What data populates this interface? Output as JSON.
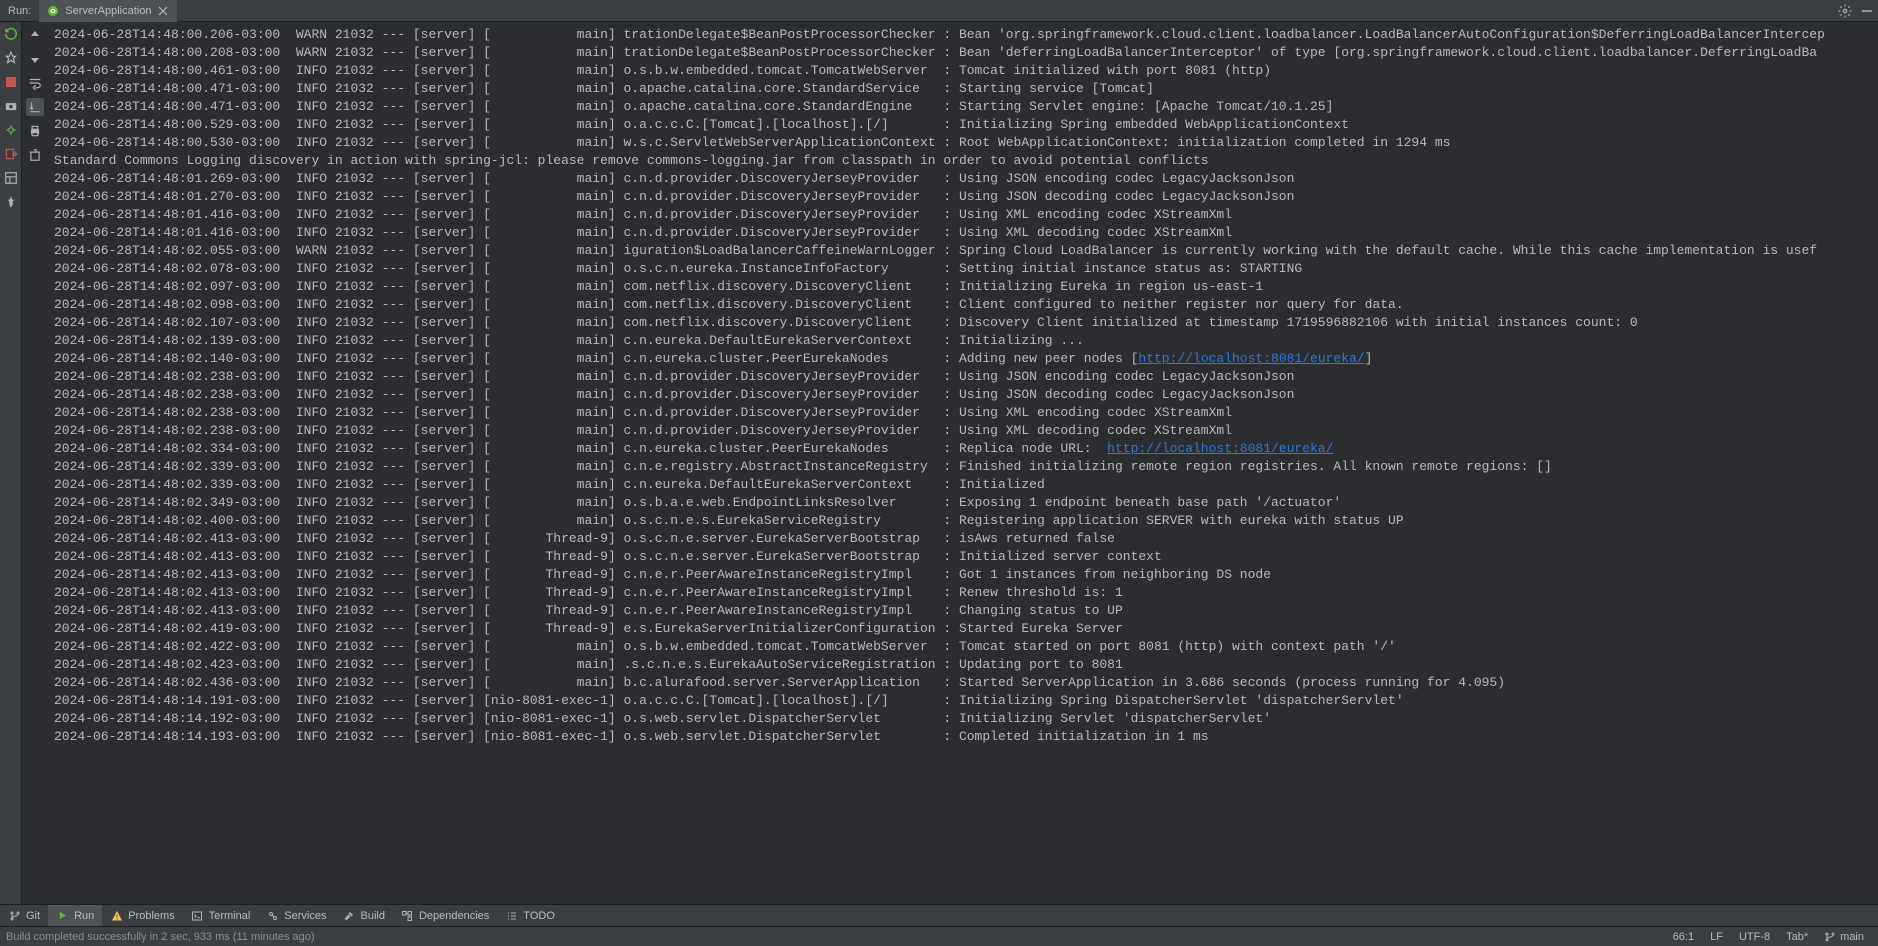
{
  "header": {
    "run_label": "Run:",
    "tab_name": "ServerApplication"
  },
  "log_links": {
    "17": "http://localhost:8081/eureka/",
    "22": "http://localhost:8081/eureka/"
  },
  "logs": [
    {
      "ts": "2024-06-28T14:48:00.206-03:00",
      "lvl": "WARN",
      "pid": "21032",
      "thr": "[           main]",
      "cls": "trationDelegate$BeanPostProcessorChecker",
      "msg": "Bean 'org.springframework.cloud.client.loadbalancer.LoadBalancerAutoConfiguration$DeferringLoadBalancerIntercep"
    },
    {
      "ts": "2024-06-28T14:48:00.208-03:00",
      "lvl": "WARN",
      "pid": "21032",
      "thr": "[           main]",
      "cls": "trationDelegate$BeanPostProcessorChecker",
      "msg": "Bean 'deferringLoadBalancerInterceptor' of type [org.springframework.cloud.client.loadbalancer.DeferringLoadBa"
    },
    {
      "ts": "2024-06-28T14:48:00.461-03:00",
      "lvl": "INFO",
      "pid": "21032",
      "thr": "[           main]",
      "cls": "o.s.b.w.embedded.tomcat.TomcatWebServer ",
      "msg": "Tomcat initialized with port 8081 (http)"
    },
    {
      "ts": "2024-06-28T14:48:00.471-03:00",
      "lvl": "INFO",
      "pid": "21032",
      "thr": "[           main]",
      "cls": "o.apache.catalina.core.StandardService  ",
      "msg": "Starting service [Tomcat]"
    },
    {
      "ts": "2024-06-28T14:48:00.471-03:00",
      "lvl": "INFO",
      "pid": "21032",
      "thr": "[           main]",
      "cls": "o.apache.catalina.core.StandardEngine   ",
      "msg": "Starting Servlet engine: [Apache Tomcat/10.1.25]"
    },
    {
      "ts": "2024-06-28T14:48:00.529-03:00",
      "lvl": "INFO",
      "pid": "21032",
      "thr": "[           main]",
      "cls": "o.a.c.c.C.[Tomcat].[localhost].[/]      ",
      "msg": "Initializing Spring embedded WebApplicationContext"
    },
    {
      "ts": "2024-06-28T14:48:00.530-03:00",
      "lvl": "INFO",
      "pid": "21032",
      "thr": "[           main]",
      "cls": "w.s.c.ServletWebServerApplicationContext",
      "msg": "Root WebApplicationContext: initialization completed in 1294 ms"
    },
    {
      "raw": "Standard Commons Logging discovery in action with spring-jcl: please remove commons-logging.jar from classpath in order to avoid potential conflicts"
    },
    {
      "ts": "2024-06-28T14:48:01.269-03:00",
      "lvl": "INFO",
      "pid": "21032",
      "thr": "[           main]",
      "cls": "c.n.d.provider.DiscoveryJerseyProvider  ",
      "msg": "Using JSON encoding codec LegacyJacksonJson"
    },
    {
      "ts": "2024-06-28T14:48:01.270-03:00",
      "lvl": "INFO",
      "pid": "21032",
      "thr": "[           main]",
      "cls": "c.n.d.provider.DiscoveryJerseyProvider  ",
      "msg": "Using JSON decoding codec LegacyJacksonJson"
    },
    {
      "ts": "2024-06-28T14:48:01.416-03:00",
      "lvl": "INFO",
      "pid": "21032",
      "thr": "[           main]",
      "cls": "c.n.d.provider.DiscoveryJerseyProvider  ",
      "msg": "Using XML encoding codec XStreamXml"
    },
    {
      "ts": "2024-06-28T14:48:01.416-03:00",
      "lvl": "INFO",
      "pid": "21032",
      "thr": "[           main]",
      "cls": "c.n.d.provider.DiscoveryJerseyProvider  ",
      "msg": "Using XML decoding codec XStreamXml"
    },
    {
      "ts": "2024-06-28T14:48:02.055-03:00",
      "lvl": "WARN",
      "pid": "21032",
      "thr": "[           main]",
      "cls": "iguration$LoadBalancerCaffeineWarnLogger",
      "msg": "Spring Cloud LoadBalancer is currently working with the default cache. While this cache implementation is usef"
    },
    {
      "ts": "2024-06-28T14:48:02.078-03:00",
      "lvl": "INFO",
      "pid": "21032",
      "thr": "[           main]",
      "cls": "o.s.c.n.eureka.InstanceInfoFactory      ",
      "msg": "Setting initial instance status as: STARTING"
    },
    {
      "ts": "2024-06-28T14:48:02.097-03:00",
      "lvl": "INFO",
      "pid": "21032",
      "thr": "[           main]",
      "cls": "com.netflix.discovery.DiscoveryClient   ",
      "msg": "Initializing Eureka in region us-east-1"
    },
    {
      "ts": "2024-06-28T14:48:02.098-03:00",
      "lvl": "INFO",
      "pid": "21032",
      "thr": "[           main]",
      "cls": "com.netflix.discovery.DiscoveryClient   ",
      "msg": "Client configured to neither register nor query for data."
    },
    {
      "ts": "2024-06-28T14:48:02.107-03:00",
      "lvl": "INFO",
      "pid": "21032",
      "thr": "[           main]",
      "cls": "com.netflix.discovery.DiscoveryClient   ",
      "msg": "Discovery Client initialized at timestamp 1719596882106 with initial instances count: 0"
    },
    {
      "ts": "2024-06-28T14:48:02.139-03:00",
      "lvl": "INFO",
      "pid": "21032",
      "thr": "[           main]",
      "cls": "c.n.eureka.DefaultEurekaServerContext   ",
      "msg": "Initializing ..."
    },
    {
      "ts": "2024-06-28T14:48:02.140-03:00",
      "lvl": "INFO",
      "pid": "21032",
      "thr": "[           main]",
      "cls": "c.n.eureka.cluster.PeerEurekaNodes      ",
      "msg": "Adding new peer nodes [",
      "link": "http://localhost:8081/eureka/",
      "msg2": "]"
    },
    {
      "ts": "2024-06-28T14:48:02.238-03:00",
      "lvl": "INFO",
      "pid": "21032",
      "thr": "[           main]",
      "cls": "c.n.d.provider.DiscoveryJerseyProvider  ",
      "msg": "Using JSON encoding codec LegacyJacksonJson"
    },
    {
      "ts": "2024-06-28T14:48:02.238-03:00",
      "lvl": "INFO",
      "pid": "21032",
      "thr": "[           main]",
      "cls": "c.n.d.provider.DiscoveryJerseyProvider  ",
      "msg": "Using JSON decoding codec LegacyJacksonJson"
    },
    {
      "ts": "2024-06-28T14:48:02.238-03:00",
      "lvl": "INFO",
      "pid": "21032",
      "thr": "[           main]",
      "cls": "c.n.d.provider.DiscoveryJerseyProvider  ",
      "msg": "Using XML encoding codec XStreamXml"
    },
    {
      "ts": "2024-06-28T14:48:02.238-03:00",
      "lvl": "INFO",
      "pid": "21032",
      "thr": "[           main]",
      "cls": "c.n.d.provider.DiscoveryJerseyProvider  ",
      "msg": "Using XML decoding codec XStreamXml"
    },
    {
      "ts": "2024-06-28T14:48:02.334-03:00",
      "lvl": "INFO",
      "pid": "21032",
      "thr": "[           main]",
      "cls": "c.n.eureka.cluster.PeerEurekaNodes      ",
      "msg": "Replica node URL:  ",
      "link": "http://localhost:8081/eureka/"
    },
    {
      "ts": "2024-06-28T14:48:02.339-03:00",
      "lvl": "INFO",
      "pid": "21032",
      "thr": "[           main]",
      "cls": "c.n.e.registry.AbstractInstanceRegistry ",
      "msg": "Finished initializing remote region registries. All known remote regions: []"
    },
    {
      "ts": "2024-06-28T14:48:02.339-03:00",
      "lvl": "INFO",
      "pid": "21032",
      "thr": "[           main]",
      "cls": "c.n.eureka.DefaultEurekaServerContext   ",
      "msg": "Initialized"
    },
    {
      "ts": "2024-06-28T14:48:02.349-03:00",
      "lvl": "INFO",
      "pid": "21032",
      "thr": "[           main]",
      "cls": "o.s.b.a.e.web.EndpointLinksResolver     ",
      "msg": "Exposing 1 endpoint beneath base path '/actuator'"
    },
    {
      "ts": "2024-06-28T14:48:02.400-03:00",
      "lvl": "INFO",
      "pid": "21032",
      "thr": "[           main]",
      "cls": "o.s.c.n.e.s.EurekaServiceRegistry       ",
      "msg": "Registering application SERVER with eureka with status UP"
    },
    {
      "ts": "2024-06-28T14:48:02.413-03:00",
      "lvl": "INFO",
      "pid": "21032",
      "thr": "[       Thread-9]",
      "cls": "o.s.c.n.e.server.EurekaServerBootstrap  ",
      "msg": "isAws returned false"
    },
    {
      "ts": "2024-06-28T14:48:02.413-03:00",
      "lvl": "INFO",
      "pid": "21032",
      "thr": "[       Thread-9]",
      "cls": "o.s.c.n.e.server.EurekaServerBootstrap  ",
      "msg": "Initialized server context"
    },
    {
      "ts": "2024-06-28T14:48:02.413-03:00",
      "lvl": "INFO",
      "pid": "21032",
      "thr": "[       Thread-9]",
      "cls": "c.n.e.r.PeerAwareInstanceRegistryImpl   ",
      "msg": "Got 1 instances from neighboring DS node"
    },
    {
      "ts": "2024-06-28T14:48:02.413-03:00",
      "lvl": "INFO",
      "pid": "21032",
      "thr": "[       Thread-9]",
      "cls": "c.n.e.r.PeerAwareInstanceRegistryImpl   ",
      "msg": "Renew threshold is: 1"
    },
    {
      "ts": "2024-06-28T14:48:02.413-03:00",
      "lvl": "INFO",
      "pid": "21032",
      "thr": "[       Thread-9]",
      "cls": "c.n.e.r.PeerAwareInstanceRegistryImpl   ",
      "msg": "Changing status to UP"
    },
    {
      "ts": "2024-06-28T14:48:02.419-03:00",
      "lvl": "INFO",
      "pid": "21032",
      "thr": "[       Thread-9]",
      "cls": "e.s.EurekaServerInitializerConfiguration",
      "msg": "Started Eureka Server"
    },
    {
      "ts": "2024-06-28T14:48:02.422-03:00",
      "lvl": "INFO",
      "pid": "21032",
      "thr": "[           main]",
      "cls": "o.s.b.w.embedded.tomcat.TomcatWebServer ",
      "msg": "Tomcat started on port 8081 (http) with context path '/'"
    },
    {
      "ts": "2024-06-28T14:48:02.423-03:00",
      "lvl": "INFO",
      "pid": "21032",
      "thr": "[           main]",
      "cls": ".s.c.n.e.s.EurekaAutoServiceRegistration",
      "msg": "Updating port to 8081"
    },
    {
      "ts": "2024-06-28T14:48:02.436-03:00",
      "lvl": "INFO",
      "pid": "21032",
      "thr": "[           main]",
      "cls": "b.c.alurafood.server.ServerApplication  ",
      "msg": "Started ServerApplication in 3.686 seconds (process running for 4.095)"
    },
    {
      "ts": "2024-06-28T14:48:14.191-03:00",
      "lvl": "INFO",
      "pid": "21032",
      "thr": "[nio-8081-exec-1]",
      "cls": "o.a.c.c.C.[Tomcat].[localhost].[/]      ",
      "msg": "Initializing Spring DispatcherServlet 'dispatcherServlet'"
    },
    {
      "ts": "2024-06-28T14:48:14.192-03:00",
      "lvl": "INFO",
      "pid": "21032",
      "thr": "[nio-8081-exec-1]",
      "cls": "o.s.web.servlet.DispatcherServlet       ",
      "msg": "Initializing Servlet 'dispatcherServlet'"
    },
    {
      "ts": "2024-06-28T14:48:14.193-03:00",
      "lvl": "INFO",
      "pid": "21032",
      "thr": "[nio-8081-exec-1]",
      "cls": "o.s.web.servlet.DispatcherServlet       ",
      "msg": "Completed initialization in 1 ms"
    }
  ],
  "toolwindows": [
    {
      "icon": "branch",
      "label": "Git"
    },
    {
      "icon": "play",
      "label": "Run",
      "active": true
    },
    {
      "icon": "warn",
      "label": "Problems"
    },
    {
      "icon": "term",
      "label": "Terminal"
    },
    {
      "icon": "services",
      "label": "Services"
    },
    {
      "icon": "hammer",
      "label": "Build"
    },
    {
      "icon": "deps",
      "label": "Dependencies"
    },
    {
      "icon": "todo",
      "label": "TODO"
    }
  ],
  "status": {
    "build_msg": "Build completed successfully in 2 sec, 933 ms (11 minutes ago)",
    "caret": "66:1",
    "le": "LF",
    "enc": "UTF-8",
    "indent": "Tab*",
    "branch": "main"
  }
}
